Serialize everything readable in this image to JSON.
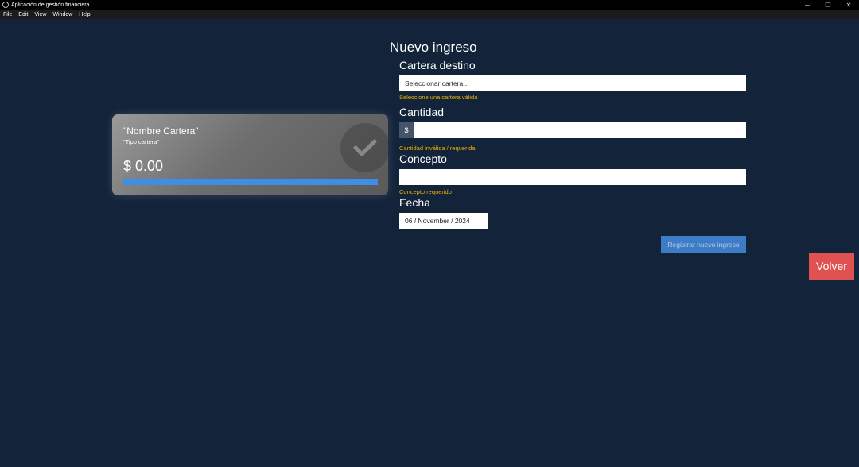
{
  "window": {
    "title": "Aplicación de gestión financiera",
    "controls": {
      "minimize": "─",
      "restore": "❐",
      "close": "✕"
    }
  },
  "menu": [
    "File",
    "Edit",
    "View",
    "Window",
    "Help"
  ],
  "wallet_card": {
    "name": "\"Nombre Cartera\"",
    "type": "\"Tipo cartera\"",
    "balance": "$ 0.00",
    "progress": 1.0,
    "bar_color": "#3f8ee6",
    "badge_icon": "check-icon"
  },
  "form": {
    "title": "Nuevo ingreso",
    "wallet": {
      "label": "Cartera destino",
      "placeholder": "Seleccionar cartera...",
      "error": "Seleccione una cartera válida"
    },
    "amount": {
      "label": "Cantidad",
      "currency": "$",
      "value": "",
      "error": "Cantidad inválida / requerida"
    },
    "concept": {
      "label": "Concepto",
      "value": "",
      "error": "Concepto requerido"
    },
    "date": {
      "label": "Fecha",
      "value": "06 / November / 2024"
    },
    "submit_label": "Registrar nuevo ingreso"
  },
  "back_label": "Volver",
  "colors": {
    "background": "#12233a",
    "error": "#f0b400",
    "primary": "#3d7cc6",
    "danger": "#e05252"
  }
}
